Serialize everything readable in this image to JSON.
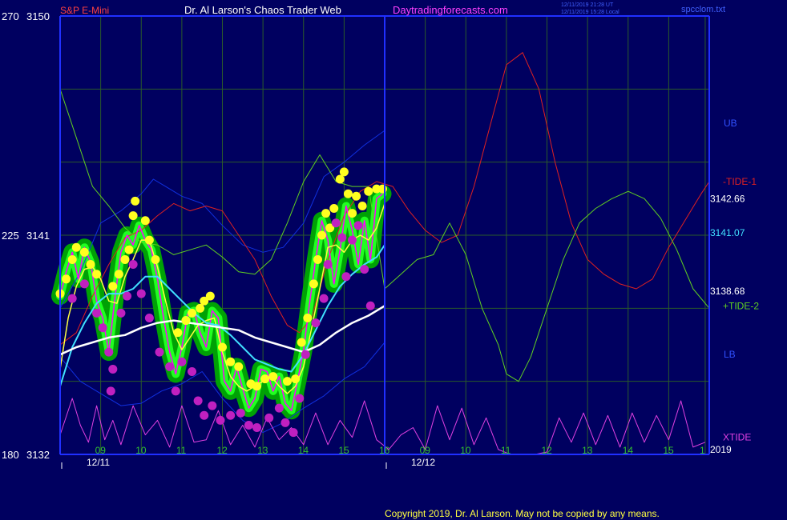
{
  "header": {
    "symbol": "S&P E-Mini",
    "title": "Dr. Al Larson's Chaos Trader Web",
    "site": "Daytradingforecasts.com",
    "ut_stamp": "12/11/2019 21:28 UT",
    "local_stamp": "12/11/2019 15:28 Local",
    "file": "spcclom.txt"
  },
  "footer": {
    "copyright": "Copyright 2019, Dr. Al Larson. May not be copied by any means."
  },
  "colors": {
    "background": "#000060",
    "grid": "#2a5a2a",
    "frame": "#2030ff",
    "price": "#ff00ff",
    "green_bands": "#00aa00",
    "fast_ma": "#ffff40",
    "mid_ma": "#40e0ff",
    "slow_ma": "#ffffff",
    "ub_lb": "#1030e0",
    "tide_minus1": "#e02020",
    "tide_plus2": "#60d020",
    "xtide": "#e040e0"
  },
  "chart_data": {
    "type": "line",
    "title": "S&P E-Mini",
    "ylim": [
      3132,
      3150
    ],
    "left_axis": [
      {
        "label": "270",
        "price": "3150",
        "y": 3150
      },
      {
        "label": "225",
        "price": "3141",
        "y": 3141
      },
      {
        "label": "180",
        "price": "3132",
        "y": 3132
      }
    ],
    "right_axis_labels": [
      {
        "text": "UB",
        "y": 3145.6,
        "color": "#3050ff"
      },
      {
        "text": "-TIDE-1",
        "y": 3143.2,
        "color": "#e02020"
      },
      {
        "text": "3142.66",
        "y": 3142.5,
        "color": "#ffffff"
      },
      {
        "text": "3141.07",
        "y": 3141.1,
        "color": "#40e0ff"
      },
      {
        "text": "3138.68",
        "y": 3138.7,
        "color": "#ffffff"
      },
      {
        "text": "+TIDE-2",
        "y": 3138.1,
        "color": "#60d020"
      },
      {
        "text": "LB",
        "y": 3136.1,
        "color": "#3050ff"
      },
      {
        "text": "XTIDE",
        "y": 3132.7,
        "color": "#e040e0"
      },
      {
        "text": "2019",
        "y": 3132.2,
        "color": "#ffffff"
      }
    ],
    "x_range": [
      0,
      16
    ],
    "hour_ticks": [
      {
        "label": "09",
        "x": 1.0
      },
      {
        "label": "10",
        "x": 2.0
      },
      {
        "label": "11",
        "x": 3.0
      },
      {
        "label": "12",
        "x": 4.0
      },
      {
        "label": "13",
        "x": 5.0
      },
      {
        "label": "14",
        "x": 6.0
      },
      {
        "label": "15",
        "x": 7.0
      },
      {
        "label": "16",
        "x": 8.0
      },
      {
        "label": "09",
        "x": 9.0
      },
      {
        "label": "10",
        "x": 10.0
      },
      {
        "label": "11",
        "x": 11.0
      },
      {
        "label": "12",
        "x": 12.0
      },
      {
        "label": "13",
        "x": 13.0
      },
      {
        "label": "14",
        "x": 14.0
      },
      {
        "label": "15",
        "x": 15.0
      },
      {
        "label": "1",
        "x": 15.9
      }
    ],
    "date_labels": [
      {
        "label": "12/11",
        "x": 0.75
      },
      {
        "label": "12/12",
        "x": 8.75
      }
    ],
    "now_x": 8.0,
    "series": [
      {
        "name": "UB",
        "color": "#1030e0",
        "x": [
          0,
          0.5,
          1.0,
          1.5,
          2.0,
          2.3,
          2.6,
          3.0,
          3.5,
          4.0,
          4.5,
          5.0,
          5.5,
          6.0,
          6.5,
          7.0,
          7.5,
          8.0
        ],
        "y": [
          3138.0,
          3139.5,
          3141.5,
          3142.0,
          3142.7,
          3143.3,
          3143.0,
          3142.6,
          3142.3,
          3141.4,
          3140.6,
          3140.3,
          3140.5,
          3141.5,
          3143.4,
          3144.0,
          3144.7,
          3145.3
        ]
      },
      {
        "name": "LB",
        "color": "#1030e0",
        "x": [
          0,
          0.5,
          1.0,
          1.5,
          2.0,
          2.5,
          3.0,
          3.5,
          4.0,
          4.5,
          5.0,
          5.5,
          6.0,
          6.5,
          7.0,
          7.5,
          8.0
        ],
        "y": [
          3136.0,
          3135.0,
          3134.5,
          3134.0,
          3134.1,
          3134.6,
          3134.9,
          3135.4,
          3134.3,
          3133.4,
          3132.9,
          3133.3,
          3133.9,
          3134.4,
          3135.1,
          3135.6,
          3136.6
        ]
      },
      {
        "name": "-TIDE-1",
        "color": "#e02020",
        "x": [
          0,
          0.4,
          0.8,
          1.2,
          1.6,
          2.0,
          2.4,
          2.8,
          3.2,
          3.6,
          4.0,
          4.4,
          4.8,
          5.2,
          5.6,
          5.9,
          6.2,
          6.6,
          7.0,
          7.4,
          7.8,
          8.2,
          8.6,
          9.0,
          9.4,
          9.8,
          10.2,
          10.6,
          11.0,
          11.4,
          11.8,
          12.2,
          12.6,
          13.0,
          13.4,
          13.8,
          14.2,
          14.6,
          15.0,
          15.4,
          15.8,
          16.0
        ],
        "y": [
          3136.5,
          3137.0,
          3138.5,
          3139.8,
          3140.9,
          3141.2,
          3141.8,
          3142.3,
          3142.0,
          3142.2,
          3142.0,
          3141.0,
          3140.0,
          3138.5,
          3137.3,
          3137.0,
          3137.6,
          3140.0,
          3141.8,
          3142.8,
          3143.2,
          3143.0,
          3142.0,
          3141.2,
          3140.7,
          3141.0,
          3143.0,
          3145.5,
          3148.0,
          3148.5,
          3147.0,
          3144.0,
          3141.5,
          3140.0,
          3139.4,
          3139.0,
          3138.8,
          3139.2,
          3140.5,
          3141.6,
          3142.7,
          3143.2
        ]
      },
      {
        "name": "+TIDE-2",
        "color": "#60d020",
        "x": [
          0,
          0.4,
          0.8,
          1.2,
          1.6,
          2.0,
          2.4,
          2.8,
          3.2,
          3.6,
          4.0,
          4.4,
          4.8,
          5.2,
          5.6,
          6.0,
          6.4,
          6.8,
          7.2,
          7.6,
          8.0,
          8.4,
          8.8,
          9.2,
          9.6,
          10.0,
          10.4,
          10.8,
          11.0,
          11.3,
          11.6,
          12.0,
          12.4,
          12.8,
          13.2,
          13.6,
          14.0,
          14.4,
          14.8,
          15.2,
          15.6,
          16.0
        ],
        "y": [
          3147.0,
          3145.0,
          3143.0,
          3142.2,
          3141.3,
          3140.7,
          3140.6,
          3140.2,
          3140.4,
          3140.6,
          3140.1,
          3139.5,
          3139.4,
          3140.0,
          3141.5,
          3143.2,
          3144.3,
          3143.2,
          3143.0,
          3143.0,
          3138.8,
          3139.4,
          3140.0,
          3140.2,
          3141.5,
          3140.2,
          3138.0,
          3136.5,
          3135.3,
          3135.0,
          3136.0,
          3138.0,
          3140.0,
          3141.5,
          3142.1,
          3142.5,
          3142.8,
          3142.5,
          3141.7,
          3140.4,
          3138.8,
          3138.0
        ]
      },
      {
        "name": "XTIDE",
        "color": "#e040e0",
        "x": [
          0,
          0.3,
          0.5,
          0.7,
          0.9,
          1.1,
          1.3,
          1.5,
          1.8,
          2.1,
          2.4,
          2.7,
          3.0,
          3.3,
          3.6,
          3.9,
          4.2,
          4.5,
          4.8,
          5.1,
          5.4,
          5.7,
          6.0,
          6.3,
          6.6,
          6.9,
          7.2,
          7.5,
          7.8,
          8.1,
          8.4,
          8.7,
          9.0,
          9.3,
          9.6,
          9.9,
          10.2,
          10.5,
          10.8,
          11.1,
          11.4,
          11.7,
          12.0,
          12.3,
          12.6,
          12.9,
          13.2,
          13.5,
          13.8,
          14.1,
          14.4,
          14.7,
          15.0,
          15.3,
          15.6,
          15.9
        ],
        "y": [
          3132.8,
          3134.3,
          3133.2,
          3132.5,
          3134.0,
          3132.6,
          3133.4,
          3132.4,
          3134.0,
          3132.8,
          3133.4,
          3132.3,
          3134.0,
          3132.5,
          3132.6,
          3133.8,
          3132.4,
          3133.2,
          3132.3,
          3133.5,
          3132.6,
          3133.1,
          3132.4,
          3133.7,
          3132.4,
          3133.4,
          3132.7,
          3134.2,
          3132.6,
          3132.2,
          3132.8,
          3133.1,
          3132.2,
          3134.0,
          3132.6,
          3133.9,
          3132.4,
          3133.5,
          3132.2,
          3132.0,
          3132.0,
          3132.0,
          3132.1,
          3133.5,
          3132.5,
          3133.7,
          3132.4,
          3133.6,
          3132.3,
          3133.7,
          3132.5,
          3133.6,
          3132.6,
          3134.2,
          3132.3,
          3132.5
        ]
      },
      {
        "name": "Price",
        "color": "#ff00ff",
        "x": [
          0,
          0.15,
          0.3,
          0.45,
          0.6,
          0.75,
          0.9,
          1.05,
          1.2,
          1.35,
          1.5,
          1.65,
          1.8,
          1.95,
          2.1,
          2.25,
          2.4,
          2.55,
          2.7,
          2.85,
          3.0,
          3.15,
          3.3,
          3.45,
          3.6,
          3.75,
          3.9,
          4.05,
          4.2,
          4.35,
          4.5,
          4.65,
          4.8,
          4.95,
          5.1,
          5.25,
          5.4,
          5.55,
          5.7,
          5.85,
          6.0,
          6.15,
          6.3,
          6.45,
          6.6,
          6.75,
          6.9,
          7.05,
          7.2,
          7.35,
          7.5,
          7.65,
          7.8,
          7.95
        ],
        "y": [
          3138.5,
          3139.5,
          3140.3,
          3139.2,
          3140.5,
          3139.9,
          3138.3,
          3137.6,
          3136.2,
          3138.4,
          3140.3,
          3141.0,
          3140.6,
          3141.4,
          3140.8,
          3140.4,
          3139.2,
          3137.6,
          3136.2,
          3135.3,
          3136.4,
          3137.8,
          3137.9,
          3137.0,
          3136.4,
          3137.9,
          3137.6,
          3135.0,
          3134.6,
          3135.6,
          3134.7,
          3133.9,
          3134.3,
          3135.5,
          3135.4,
          3134.6,
          3135.2,
          3134.1,
          3133.8,
          3135.0,
          3136.3,
          3138.2,
          3140.0,
          3141.6,
          3140.8,
          3139.0,
          3140.4,
          3142.2,
          3141.2,
          3139.8,
          3141.6,
          3140.0,
          3142.5,
          3142.7
        ]
      },
      {
        "name": "Fast MA",
        "color": "#ffff40",
        "x": [
          0,
          0.2,
          0.4,
          0.6,
          0.8,
          1.0,
          1.2,
          1.4,
          1.6,
          1.8,
          2.0,
          2.2,
          2.4,
          2.6,
          2.8,
          3.0,
          3.2,
          3.4,
          3.6,
          3.8,
          4.0,
          4.2,
          4.4,
          4.6,
          4.8,
          5.0,
          5.2,
          5.4,
          5.6,
          5.8,
          6.0,
          6.2,
          6.4,
          6.6,
          6.8,
          7.0,
          7.2,
          7.4,
          7.6,
          7.8,
          8.0
        ],
        "y": [
          3135.5,
          3137.6,
          3138.9,
          3139.6,
          3139.7,
          3139.2,
          3138.3,
          3138.2,
          3139.3,
          3140.0,
          3140.8,
          3140.8,
          3139.7,
          3138.3,
          3137.0,
          3136.3,
          3136.8,
          3137.3,
          3137.5,
          3137.6,
          3136.2,
          3135.2,
          3134.8,
          3134.6,
          3134.8,
          3135.0,
          3135.2,
          3134.8,
          3134.5,
          3134.8,
          3135.6,
          3137.2,
          3138.8,
          3140.5,
          3140.6,
          3140.3,
          3140.8,
          3141.0,
          3140.8,
          3141.3,
          3142.3
        ]
      },
      {
        "name": "Mid MA",
        "color": "#40e0ff",
        "x": [
          0,
          0.3,
          0.6,
          0.9,
          1.2,
          1.5,
          1.8,
          2.1,
          2.4,
          2.7,
          3.0,
          3.3,
          3.6,
          3.9,
          4.2,
          4.5,
          4.8,
          5.1,
          5.4,
          5.7,
          6.0,
          6.3,
          6.6,
          6.9,
          7.2,
          7.5,
          7.8,
          8.0
        ],
        "y": [
          3134.8,
          3136.4,
          3137.4,
          3138.2,
          3138.6,
          3138.6,
          3138.8,
          3139.3,
          3139.3,
          3138.8,
          3138.3,
          3137.8,
          3137.4,
          3137.3,
          3136.9,
          3136.4,
          3135.9,
          3135.7,
          3135.5,
          3135.4,
          3136.1,
          3137.1,
          3138.1,
          3138.9,
          3139.4,
          3139.8,
          3140.1,
          3140.6
        ]
      },
      {
        "name": "Slow MA",
        "color": "#ffffff",
        "x": [
          0,
          0.4,
          0.8,
          1.2,
          1.6,
          2.0,
          2.4,
          2.8,
          3.2,
          3.6,
          4.0,
          4.4,
          4.8,
          5.2,
          5.6,
          6.0,
          6.4,
          6.8,
          7.2,
          7.6,
          8.0
        ],
        "y": [
          3136.1,
          3136.4,
          3136.6,
          3136.8,
          3136.9,
          3137.2,
          3137.4,
          3137.5,
          3137.4,
          3137.3,
          3137.2,
          3137.1,
          3136.8,
          3136.6,
          3136.4,
          3136.2,
          3136.5,
          3137.0,
          3137.4,
          3137.7,
          3138.1
        ]
      }
    ],
    "markers": {
      "yellow_highs": [
        [
          0,
          3138.6
        ],
        [
          0.15,
          3139.2
        ],
        [
          0.3,
          3140.0
        ],
        [
          0.4,
          3140.5
        ],
        [
          0.6,
          3140.3
        ],
        [
          0.75,
          3139.8
        ],
        [
          0.9,
          3139.4
        ],
        [
          1.3,
          3138.9
        ],
        [
          1.45,
          3139.4
        ],
        [
          1.6,
          3140.0
        ],
        [
          1.7,
          3140.4
        ],
        [
          1.8,
          3141.8
        ],
        [
          1.85,
          3142.4
        ],
        [
          2.1,
          3141.6
        ],
        [
          2.2,
          3140.8
        ],
        [
          2.35,
          3140.0
        ],
        [
          2.9,
          3137.0
        ],
        [
          3.1,
          3137.5
        ],
        [
          3.25,
          3137.8
        ],
        [
          3.45,
          3138.0
        ],
        [
          3.55,
          3138.3
        ],
        [
          3.7,
          3138.5
        ],
        [
          4.0,
          3136.4
        ],
        [
          4.2,
          3135.8
        ],
        [
          4.4,
          3135.6
        ],
        [
          4.7,
          3134.9
        ],
        [
          4.85,
          3134.8
        ],
        [
          5.05,
          3135.1
        ],
        [
          5.25,
          3135.2
        ],
        [
          5.6,
          3135.0
        ],
        [
          5.8,
          3135.1
        ],
        [
          5.95,
          3136.6
        ],
        [
          6.1,
          3137.6
        ],
        [
          6.25,
          3139.0
        ],
        [
          6.35,
          3140.0
        ],
        [
          6.45,
          3141.0
        ],
        [
          6.55,
          3141.9
        ],
        [
          6.65,
          3141.3
        ],
        [
          6.75,
          3142.1
        ],
        [
          6.9,
          3143.3
        ],
        [
          7.0,
          3143.6
        ],
        [
          7.1,
          3142.7
        ],
        [
          7.2,
          3141.9
        ],
        [
          7.3,
          3142.6
        ],
        [
          7.45,
          3142.2
        ],
        [
          7.6,
          3142.8
        ],
        [
          7.8,
          3142.9
        ],
        [
          7.95,
          3142.9
        ]
      ],
      "magenta_lows": [
        [
          0.3,
          3138.4
        ],
        [
          0.6,
          3139.0
        ],
        [
          0.9,
          3137.8
        ],
        [
          1.05,
          3137.2
        ],
        [
          1.2,
          3136.2
        ],
        [
          1.3,
          3135.5
        ],
        [
          1.25,
          3134.6
        ],
        [
          1.5,
          3137.8
        ],
        [
          1.65,
          3138.5
        ],
        [
          1.8,
          3139.8
        ],
        [
          2.0,
          3138.6
        ],
        [
          2.2,
          3137.6
        ],
        [
          2.45,
          3136.2
        ],
        [
          2.7,
          3135.6
        ],
        [
          2.85,
          3134.6
        ],
        [
          3.0,
          3135.8
        ],
        [
          3.25,
          3135.4
        ],
        [
          3.4,
          3134.2
        ],
        [
          3.55,
          3133.6
        ],
        [
          3.75,
          3134.0
        ],
        [
          3.95,
          3133.4
        ],
        [
          4.2,
          3133.6
        ],
        [
          4.45,
          3133.7
        ],
        [
          4.65,
          3133.2
        ],
        [
          4.85,
          3133.1
        ],
        [
          5.15,
          3133.5
        ],
        [
          5.4,
          3133.9
        ],
        [
          5.55,
          3133.3
        ],
        [
          5.75,
          3132.9
        ],
        [
          5.9,
          3134.3
        ],
        [
          6.05,
          3136.1
        ],
        [
          6.3,
          3137.4
        ],
        [
          6.5,
          3138.4
        ],
        [
          6.6,
          3139.8
        ],
        [
          6.8,
          3141.5
        ],
        [
          6.95,
          3140.9
        ],
        [
          7.05,
          3139.3
        ],
        [
          7.2,
          3140.8
        ],
        [
          7.35,
          3141.4
        ],
        [
          7.5,
          3139.6
        ],
        [
          7.65,
          3138.1
        ]
      ]
    }
  }
}
